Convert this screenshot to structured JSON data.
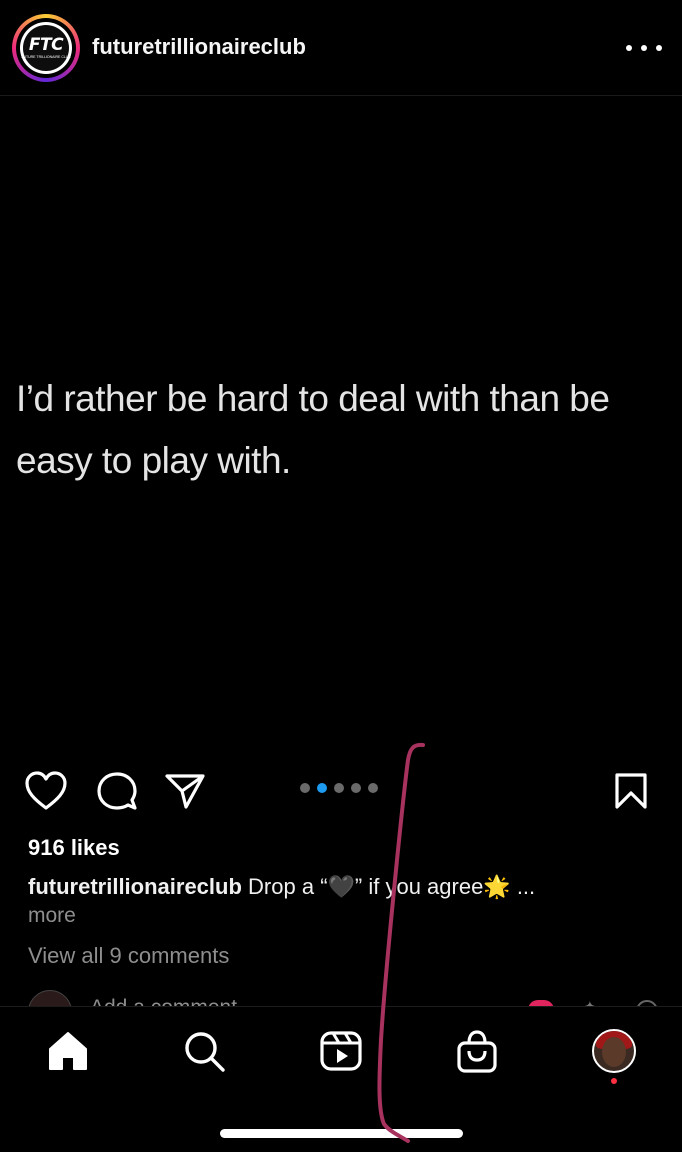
{
  "header": {
    "avatar_logo_text": "FTC",
    "avatar_logo_subtext": "FUTURE TRILLIONAIRE CLUB",
    "username": "futuretrillionaireclub",
    "more_icon": "more-horizontal-icon"
  },
  "post": {
    "text": "I’d rather be hard to deal with than be easy to play with.",
    "carousel": {
      "count": 5,
      "active_index": 1
    }
  },
  "actions": {
    "like_icon": "heart-outline-icon",
    "comment_icon": "comment-bubble-icon",
    "share_icon": "paper-plane-icon",
    "save_icon": "bookmark-outline-icon"
  },
  "meta": {
    "likes": "916 likes",
    "caption_user": "futuretrillionaireclub",
    "caption_text": "Drop a “🖤” if you agree🌟 ...",
    "more_label": "more",
    "view_comments": "View all 9 comments"
  },
  "comment_input": {
    "placeholder_partial": "Add a comment..."
  },
  "tabbar": {
    "items": [
      {
        "name": "home",
        "icon": "home-filled-icon"
      },
      {
        "name": "search",
        "icon": "search-icon"
      },
      {
        "name": "reels",
        "icon": "reels-icon"
      },
      {
        "name": "shop",
        "icon": "shopping-bag-icon"
      },
      {
        "name": "profile",
        "icon": "profile-avatar-icon"
      }
    ]
  },
  "colors": {
    "background": "#000000",
    "carousel_active": "#1d9bf0",
    "secondary_text": "#8e8e8e",
    "notification_dot": "#ff3040",
    "scribble": "#a8325e"
  }
}
